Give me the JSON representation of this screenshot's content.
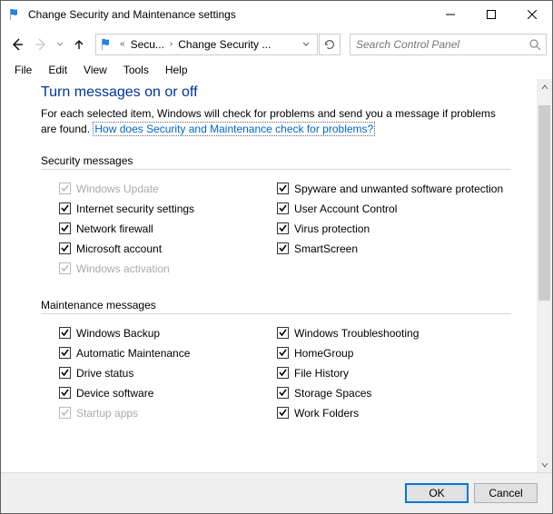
{
  "window": {
    "title": "Change Security and Maintenance settings"
  },
  "breadcrumb": {
    "guillemet": "«",
    "item1": "Secu...",
    "item2": "Change Security ..."
  },
  "search": {
    "placeholder": "Search Control Panel"
  },
  "menu": {
    "file": "File",
    "edit": "Edit",
    "view": "View",
    "tools": "Tools",
    "help": "Help"
  },
  "page": {
    "heading": "Turn messages on or off",
    "desc_prefix": "For each selected item, Windows will check for problems and send you a message if problems are found. ",
    "link": "How does Security and Maintenance check for problems?"
  },
  "sections": {
    "security": {
      "title": "Security messages",
      "left": [
        {
          "label": "Windows Update",
          "checked": true,
          "disabled": true
        },
        {
          "label": "Internet security settings",
          "checked": true,
          "disabled": false
        },
        {
          "label": "Network firewall",
          "checked": true,
          "disabled": false
        },
        {
          "label": "Microsoft account",
          "checked": true,
          "disabled": false
        },
        {
          "label": "Windows activation",
          "checked": true,
          "disabled": true
        }
      ],
      "right": [
        {
          "label": "Spyware and unwanted software protection",
          "checked": true,
          "disabled": false
        },
        {
          "label": "User Account Control",
          "checked": true,
          "disabled": false
        },
        {
          "label": "Virus protection",
          "checked": true,
          "disabled": false
        },
        {
          "label": "SmartScreen",
          "checked": true,
          "disabled": false
        }
      ]
    },
    "maintenance": {
      "title": "Maintenance messages",
      "left": [
        {
          "label": "Windows Backup",
          "checked": true,
          "disabled": false
        },
        {
          "label": "Automatic Maintenance",
          "checked": true,
          "disabled": false
        },
        {
          "label": "Drive status",
          "checked": true,
          "disabled": false
        },
        {
          "label": "Device software",
          "checked": true,
          "disabled": false
        },
        {
          "label": "Startup apps",
          "checked": true,
          "disabled": true
        }
      ],
      "right": [
        {
          "label": "Windows Troubleshooting",
          "checked": true,
          "disabled": false
        },
        {
          "label": "HomeGroup",
          "checked": true,
          "disabled": false
        },
        {
          "label": "File History",
          "checked": true,
          "disabled": false
        },
        {
          "label": "Storage Spaces",
          "checked": true,
          "disabled": false
        },
        {
          "label": "Work Folders",
          "checked": true,
          "disabled": false
        }
      ]
    }
  },
  "buttons": {
    "ok": "OK",
    "cancel": "Cancel"
  }
}
